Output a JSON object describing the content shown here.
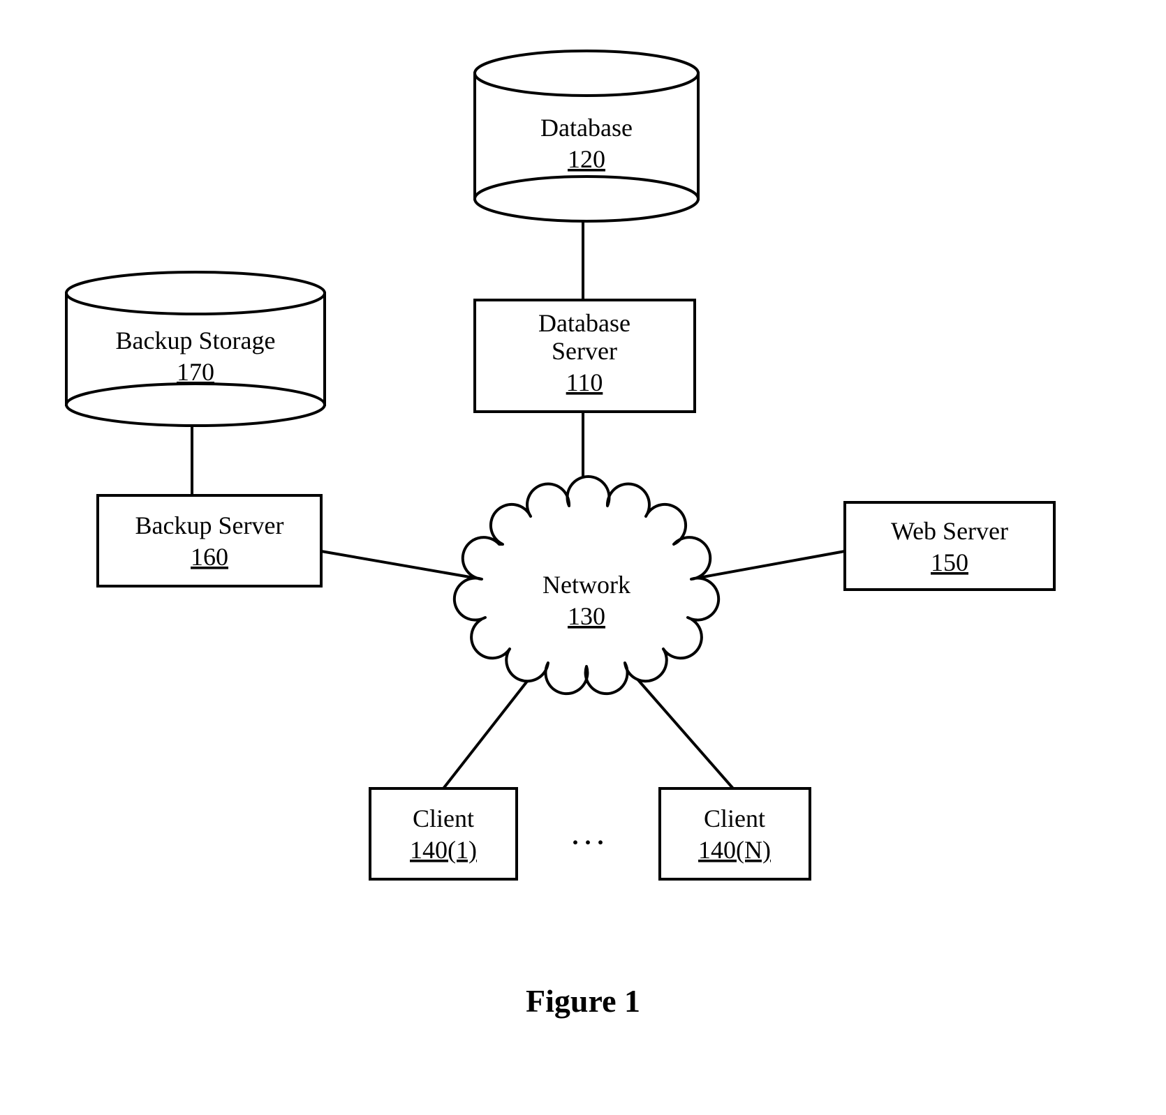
{
  "nodes": {
    "database": {
      "label": "Database",
      "num": "120"
    },
    "databaseServer": {
      "label": "Database\nServer",
      "num": "110"
    },
    "backupStorage": {
      "label": "Backup Storage",
      "num": "170"
    },
    "backupServer": {
      "label": "Backup Server",
      "num": "160"
    },
    "webServer": {
      "label": "Web Server",
      "num": "150"
    },
    "network": {
      "label": "Network",
      "num": "130"
    },
    "client1": {
      "label": "Client",
      "num": "140(1)"
    },
    "clientN": {
      "label": "Client",
      "num": "140(N)"
    },
    "ellipsis": ". . ."
  },
  "figure": "Figure 1"
}
